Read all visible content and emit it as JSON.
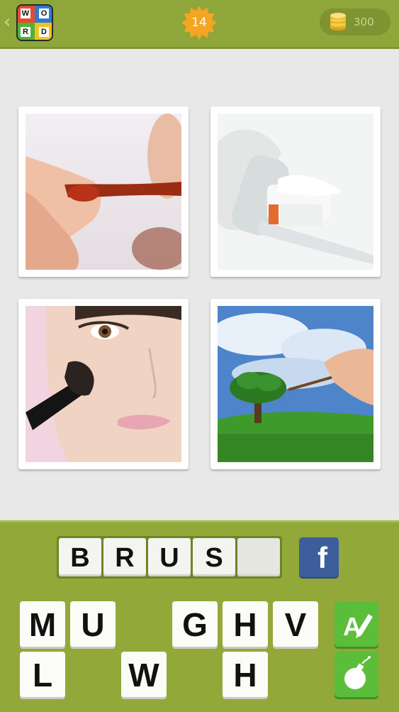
{
  "header": {
    "back_icon": "chevron-left-icon",
    "logo_letters": [
      "W",
      "O",
      "R",
      "D"
    ],
    "level": "14",
    "coins": "300",
    "coin_icon": "coin-stack-icon"
  },
  "pictures": [
    {
      "name": "nail-polish-brush-photo"
    },
    {
      "name": "toothbrush-photo"
    },
    {
      "name": "makeup-brush-photo"
    },
    {
      "name": "paint-brush-tree-photo"
    }
  ],
  "answer": {
    "slots": [
      "B",
      "R",
      "U",
      "S",
      ""
    ]
  },
  "share": {
    "icon": "facebook-icon",
    "label": "f"
  },
  "keyboard": {
    "row1": [
      "M",
      "U",
      "",
      "G",
      "H",
      "V"
    ],
    "row2": [
      "L",
      "",
      "W",
      "",
      "H",
      ""
    ]
  },
  "tools": {
    "reveal_icon": "pen-letter-icon",
    "reveal_letter": "A",
    "remove_icon": "bomb-icon"
  },
  "colors": {
    "header_green": "#8fa73a",
    "panel_green": "#92a93a",
    "badge_orange": "#f4a623",
    "facebook_blue": "#3d5d9c",
    "tool_green": "#5bbd3a"
  }
}
